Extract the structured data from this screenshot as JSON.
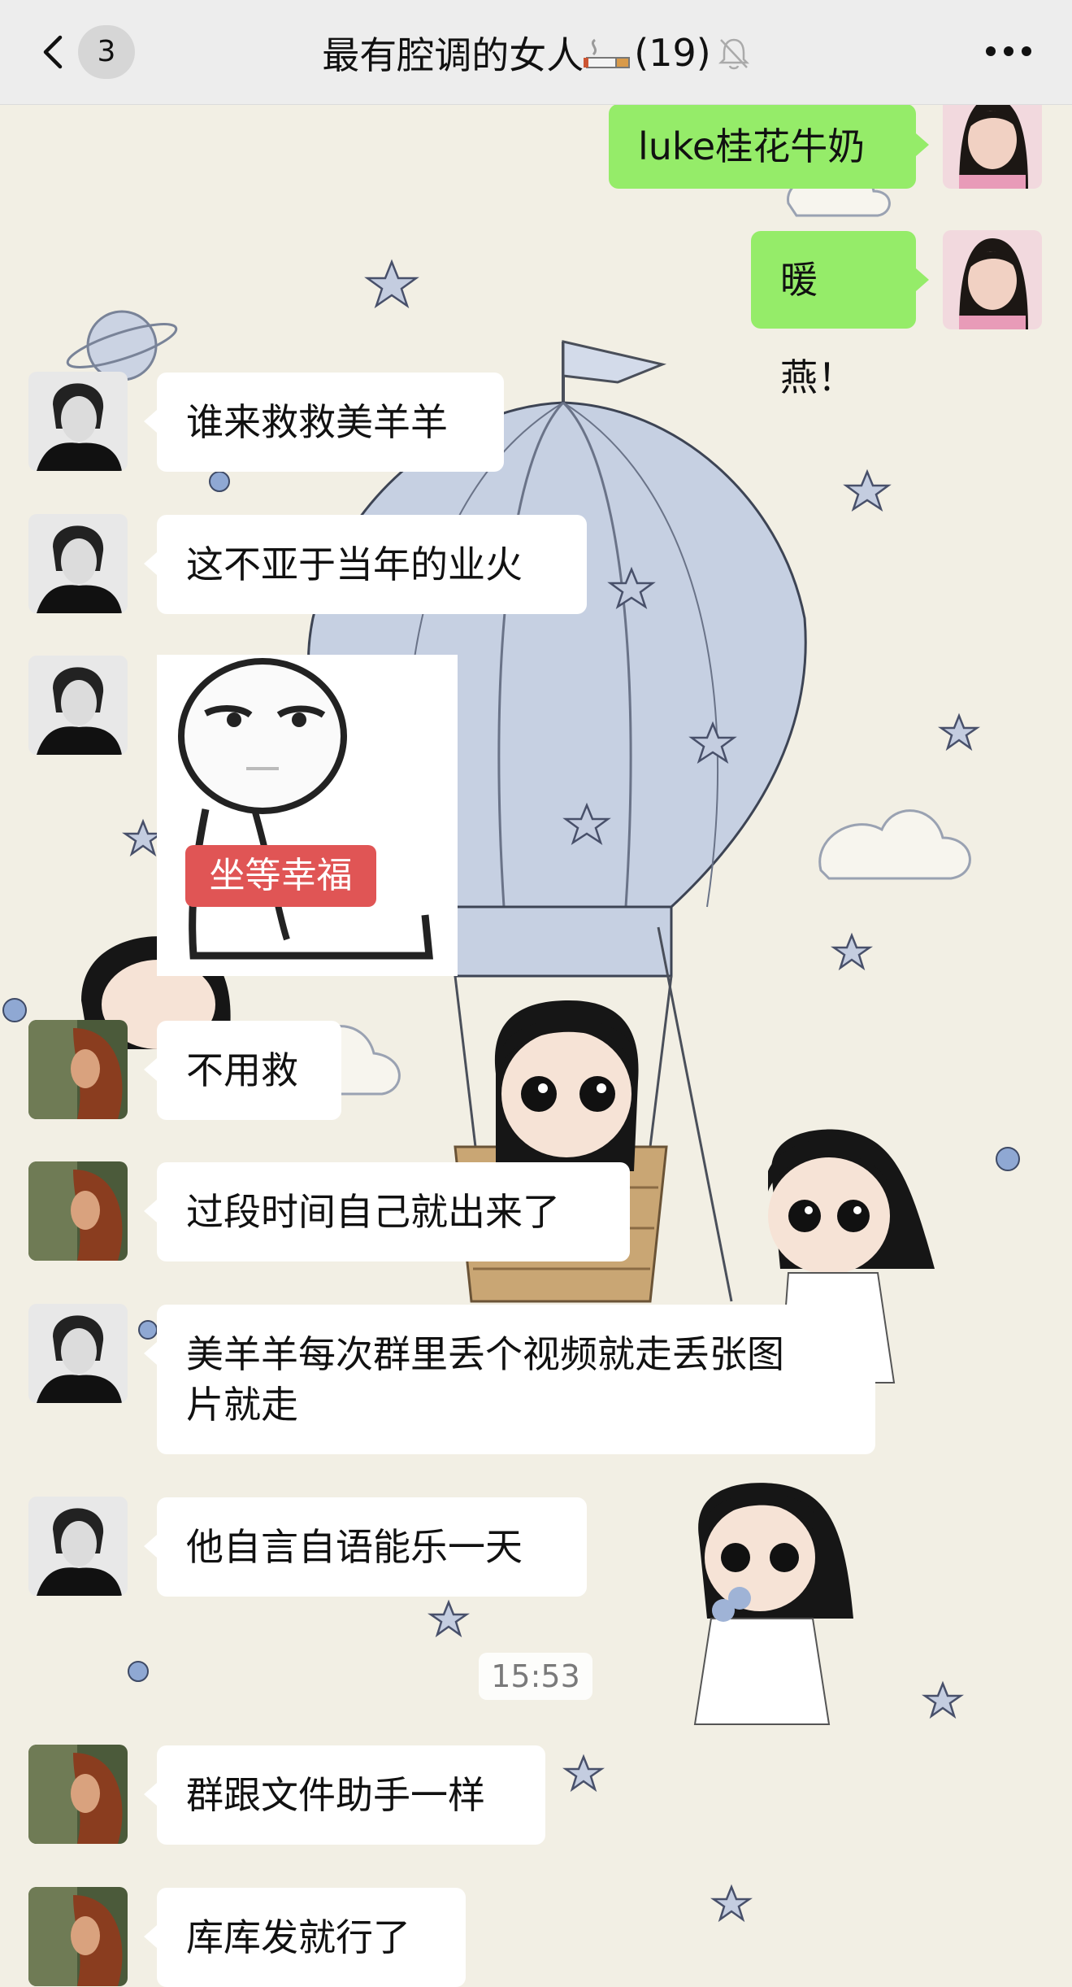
{
  "nav": {
    "unread_count": "3",
    "group_name": "最有腔调的女人",
    "member_count": "(19)",
    "back_icon": "chevron-left-icon",
    "more_icon": "more-dots-icon",
    "mute_icon": "bell-muted-icon",
    "emoji_icon": "cigarette-icon"
  },
  "messages": [
    {
      "side": "out",
      "text": "luke桂花牛奶",
      "avatar": "avatar-self"
    },
    {
      "side": "out",
      "text": "暖燕！",
      "avatar": "avatar-self"
    },
    {
      "side": "in",
      "text": "谁来救救美羊羊",
      "avatar": "avatar-bw-woman"
    },
    {
      "side": "in",
      "text": "这不亚于当年的业火",
      "avatar": "avatar-bw-woman"
    },
    {
      "side": "in",
      "sticker_text": "坐等幸福",
      "avatar": "avatar-bw-woman"
    },
    {
      "side": "in",
      "text": "不用救",
      "avatar": "avatar-redhair"
    },
    {
      "side": "in",
      "text": "过段时间自己就出来了",
      "avatar": "avatar-redhair"
    },
    {
      "side": "in",
      "text_line1": "美羊羊每次群里丢个视频就走丢张图",
      "text_line2": "片就走",
      "avatar": "avatar-bw-woman"
    },
    {
      "side": "in",
      "text": "他自言自语能乐一天",
      "avatar": "avatar-bw-woman"
    },
    {
      "side": "in",
      "text": "群跟文件助手一样",
      "avatar": "avatar-redhair"
    },
    {
      "side": "in",
      "text": "库库发就行了",
      "avatar": "avatar-redhair"
    }
  ],
  "timestamp": "15:53",
  "colors": {
    "nav_bg": "#ededed",
    "bubble_out": "#95ec69",
    "bubble_in": "#ffffff",
    "chat_bg": "#f2efe4",
    "sticker_label": "#e05555"
  }
}
